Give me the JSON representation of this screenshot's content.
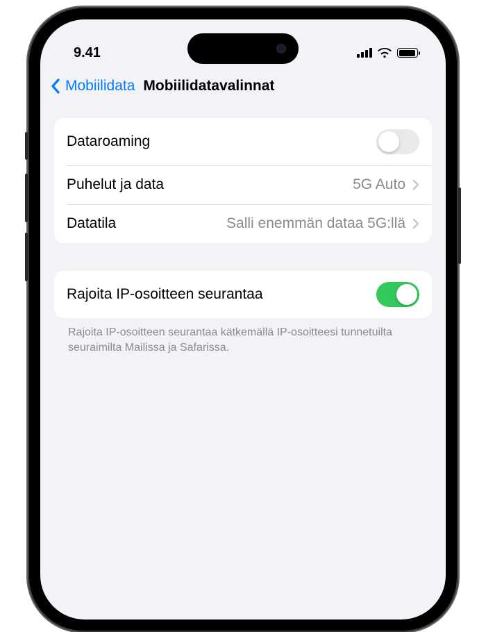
{
  "status": {
    "time": "9.41"
  },
  "nav": {
    "back_label": "Mobiilidata",
    "title": "Mobiilidatavalinnat"
  },
  "group1": {
    "roaming": {
      "label": "Dataroaming",
      "on": false
    },
    "voice_data": {
      "label": "Puhelut ja data",
      "value": "5G Auto"
    },
    "data_mode": {
      "label": "Datatila",
      "value": "Salli enemmän dataa 5G:llä"
    }
  },
  "group2": {
    "limit_ip": {
      "label": "Rajoita IP-osoitteen seurantaa",
      "on": true
    },
    "footer": "Rajoita IP-osoitteen seurantaa kätkemällä IP-osoitteesi tunnetuilta seuraimilta Mailissa ja Safarissa."
  },
  "colors": {
    "accent": "#007aff",
    "toggle_on": "#34c759",
    "bg": "#f2f2f7"
  }
}
